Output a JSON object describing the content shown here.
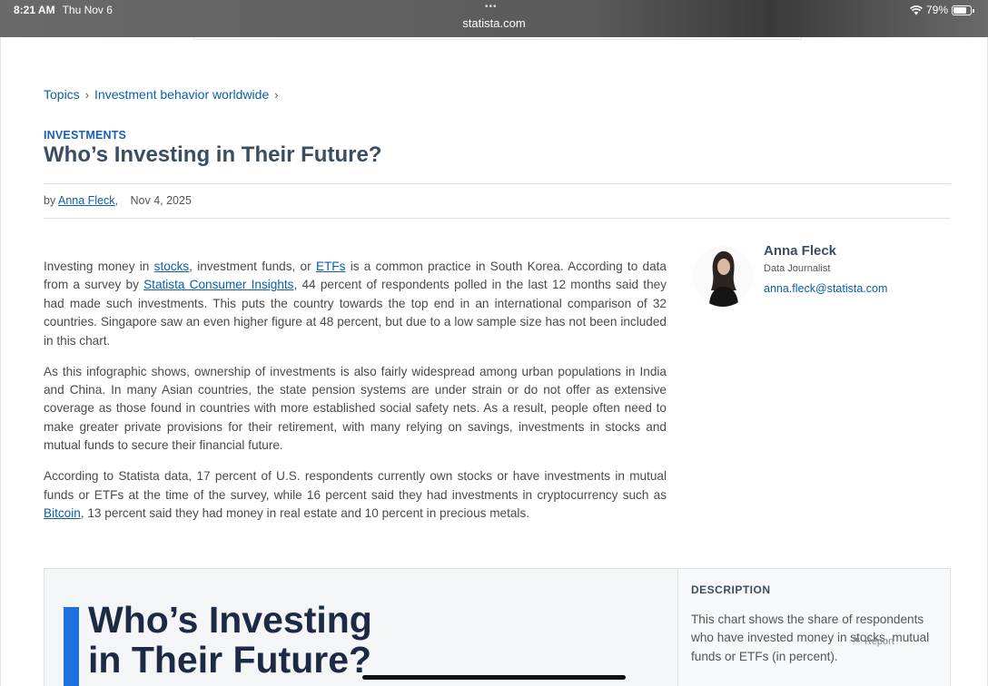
{
  "status_bar": {
    "time": "8:21 AM",
    "date": "Thu Nov 6",
    "dots": "•••",
    "url": "statista.com",
    "battery": "79%",
    "battery_level": 0.79
  },
  "breadcrumb": {
    "items": [
      {
        "label": "Topics"
      },
      {
        "label": "Investment behavior worldwide"
      }
    ],
    "separator": "›"
  },
  "article": {
    "kicker": "INVESTMENTS",
    "title": "Who’s Investing in Their Future?",
    "byline_prefix": "by",
    "author_link": "Anna Fleck",
    "date": "Nov 4, 2025",
    "paragraph1": {
      "t1": "Investing money in ",
      "link1": "stocks",
      "t2": ", investment funds, or ",
      "link2": "ETFs",
      "t3": " is a common practice in South Korea. According to data from a survey by ",
      "link3": "Statista Consumer Insights",
      "t4": ", 44 percent of respondents polled in the last 12 months said they had made such investments. This puts the country towards the top end in an international comparison of 32 countries. Singapore saw an even higher figure at 48 percent, but due to a low sample size has not been included in this chart."
    },
    "paragraph2": "As this infographic shows, ownership of investments is also fairly widespread among urban populations in India and China. In many Asian countries, the state pension systems are under strain or do not offer as extensive coverage as those found in countries with more established social safety nets. As a result, people often need to make greater private provisions for their retirement, with many relying on savings, investments in stocks and mutual funds to secure their financial future.",
    "paragraph3": {
      "t1": "According to Statista data, 17 percent of U.S. respondents currently own stocks or have investments in mutual funds or ETFs at the time of the survey, while 16 percent said they had investments in cryptocurrency such as ",
      "link1": "Bitcoin",
      "t2": ", 13 percent said they had money in real estate and 10 percent in precious metals."
    }
  },
  "author": {
    "name": "Anna Fleck",
    "role": "Data Journalist",
    "email": "anna.fleck@statista.com"
  },
  "infographic": {
    "title_line1": "Who’s Investing",
    "title_line2": "in Their Future?",
    "accent_color": "#1e6fe0",
    "description_label": "DESCRIPTION",
    "description_text": "This chart shows the share of respondents who have invested money in stocks, mutual funds or ETFs (in percent).",
    "report_label": "Report"
  }
}
